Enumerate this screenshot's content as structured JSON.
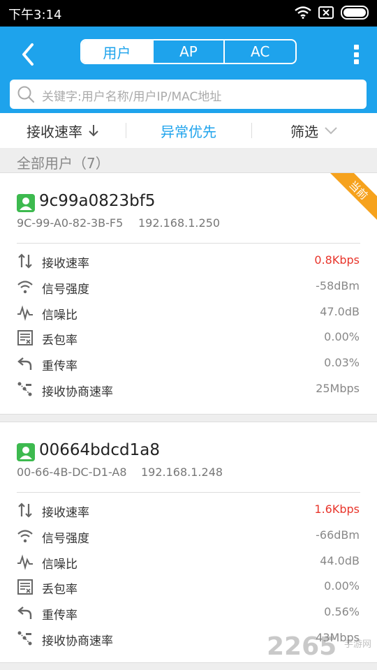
{
  "status": {
    "time": "下午3:14"
  },
  "header": {
    "tabs": [
      {
        "label": "用户",
        "active": true
      },
      {
        "label": "AP",
        "active": false
      },
      {
        "label": "AC",
        "active": false
      }
    ],
    "search_placeholder": "关键字:用户名称/用户IP/MAC地址"
  },
  "sortbar": {
    "sort_label": "接收速率",
    "priority_label": "异常优先",
    "filter_label": "筛选"
  },
  "section": {
    "title": "全部用户（7）"
  },
  "users": [
    {
      "badge": "当前",
      "name": "9c99a0823bf5",
      "mac": "9C-99-A0-82-3B-F5",
      "ip": "192.168.1.250",
      "metrics": [
        {
          "label": "接收速率",
          "value": "0.8Kbps",
          "icon": "updown-arrows-icon"
        },
        {
          "label": "信号强度",
          "value": "-58dBm",
          "icon": "wifi-icon"
        },
        {
          "label": "信噪比",
          "value": "47.0dB",
          "icon": "waveform-icon"
        },
        {
          "label": "丢包率",
          "value": "0.00%",
          "icon": "packet-loss-icon"
        },
        {
          "label": "重传率",
          "value": "0.03%",
          "icon": "retransmit-icon"
        },
        {
          "label": "接收协商速率",
          "value": "25Mbps",
          "icon": "negotiated-rate-icon"
        }
      ]
    },
    {
      "name": "00664bdcd1a8",
      "mac": "00-66-4B-DC-D1-A8",
      "ip": "192.168.1.248",
      "metrics": [
        {
          "label": "接收速率",
          "value": "1.6Kbps",
          "icon": "updown-arrows-icon"
        },
        {
          "label": "信号强度",
          "value": "-66dBm",
          "icon": "wifi-icon"
        },
        {
          "label": "信噪比",
          "value": "44.0dB",
          "icon": "waveform-icon"
        },
        {
          "label": "丢包率",
          "value": "0.00%",
          "icon": "packet-loss-icon"
        },
        {
          "label": "重传率",
          "value": "0.56%",
          "icon": "retransmit-icon"
        },
        {
          "label": "接收协商速率",
          "value": "43Mbps",
          "icon": "negotiated-rate-icon"
        }
      ]
    }
  ],
  "watermark": {
    "number": "2265",
    "suffix": "手游网"
  },
  "colors": {
    "accent": "#1ea3ec",
    "alert": "#e8352b",
    "badge": "#f6a21d",
    "user_icon": "#3dba4f"
  }
}
